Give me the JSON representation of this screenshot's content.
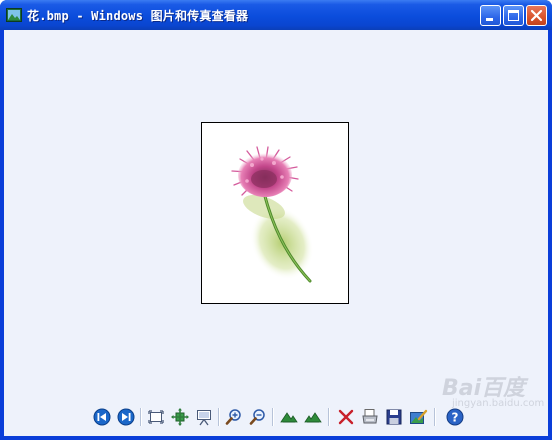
{
  "window": {
    "title": "花.bmp - Windows 图片和传真查看器",
    "controls": {
      "minimize": "minimize",
      "maximize": "maximize",
      "close": "close"
    }
  },
  "viewer": {
    "image_name": "花.bmp",
    "background_color": "#eef2fb"
  },
  "toolbar": {
    "buttons": [
      {
        "name": "previous-image-button",
        "icon": "previous-icon"
      },
      {
        "name": "next-image-button",
        "icon": "next-icon"
      },
      {
        "name": "best-fit-button",
        "icon": "best-fit-icon"
      },
      {
        "name": "actual-size-button",
        "icon": "actual-size-icon"
      },
      {
        "name": "slideshow-button",
        "icon": "slideshow-icon"
      },
      {
        "name": "zoom-in-button",
        "icon": "zoom-in-icon"
      },
      {
        "name": "zoom-out-button",
        "icon": "zoom-out-icon"
      },
      {
        "name": "rotate-clockwise-button",
        "icon": "rotate-clockwise-icon"
      },
      {
        "name": "rotate-counterclockwise-button",
        "icon": "rotate-counterclockwise-icon"
      },
      {
        "name": "delete-button",
        "icon": "delete-icon"
      },
      {
        "name": "print-button",
        "icon": "print-icon"
      },
      {
        "name": "save-button",
        "icon": "save-icon"
      },
      {
        "name": "edit-button",
        "icon": "edit-icon"
      },
      {
        "name": "help-button",
        "icon": "help-icon"
      }
    ]
  },
  "watermark": {
    "text": "Bai百度",
    "sub": "jingyan.baidu.com"
  }
}
